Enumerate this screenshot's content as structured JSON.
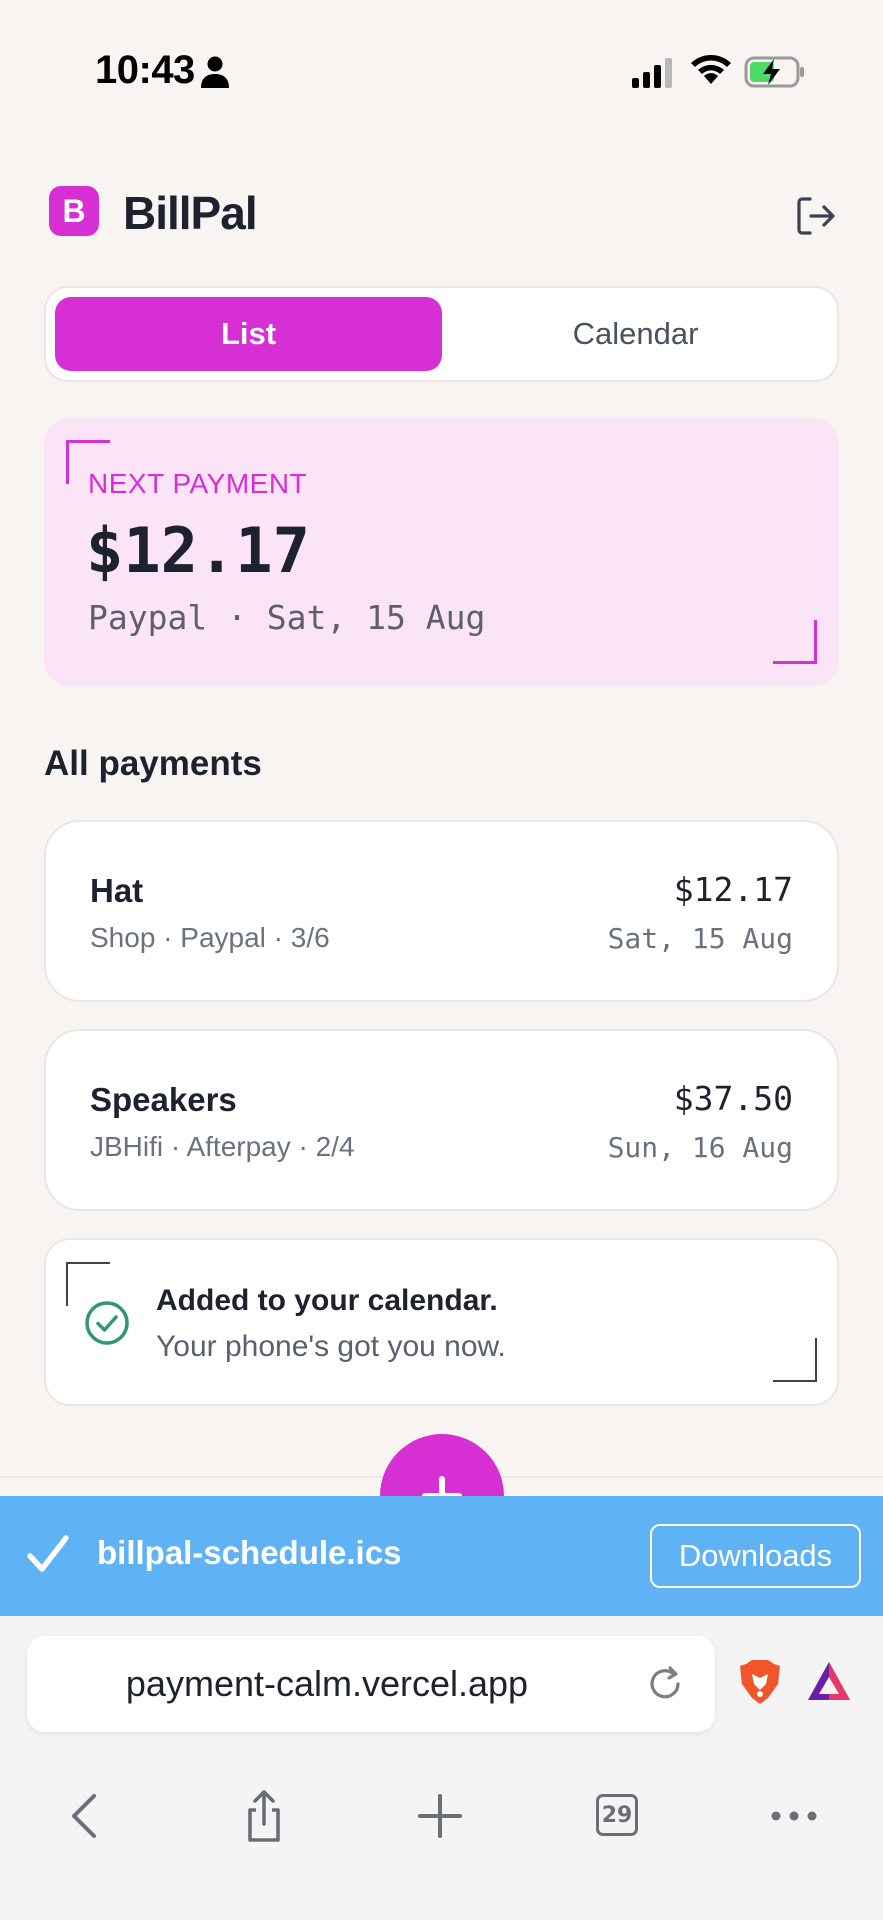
{
  "status_bar": {
    "time": "10:43"
  },
  "header": {
    "logo_letter": "B",
    "title": "BillPal"
  },
  "view_toggle": {
    "list_label": "List",
    "calendar_label": "Calendar",
    "selected": "List"
  },
  "next_payment": {
    "label": "NEXT PAYMENT",
    "amount": "$12.17",
    "detail": "Paypal · Sat, 15 Aug"
  },
  "payments_section": {
    "title": "All payments"
  },
  "payments": [
    {
      "name": "Hat",
      "meta": "Shop · Paypal · 3/6",
      "amount": "$12.17",
      "date": "Sat, 15 Aug"
    },
    {
      "name": "Speakers",
      "meta": "JBHifi · Afterpay · 2/4",
      "amount": "$37.50",
      "date": "Sun, 16 Aug"
    }
  ],
  "toast": {
    "title": "Added to your calendar.",
    "subtitle": "Your phone's got you now."
  },
  "download_banner": {
    "filename": "billpal-schedule.ics",
    "button_label": "Downloads"
  },
  "browser": {
    "url": "payment-calm.vercel.app",
    "tab_count": "29",
    "toolbar_icons": [
      "back-icon",
      "share-icon",
      "new-tab-icon",
      "tabs-icon",
      "more-icon"
    ]
  },
  "colors": {
    "accent": "#d630d4",
    "background": "#f8f4f1",
    "next_card_bg": "#fbe4f5",
    "success": "#2e9a6a",
    "download_banner": "#5fb3f5"
  }
}
